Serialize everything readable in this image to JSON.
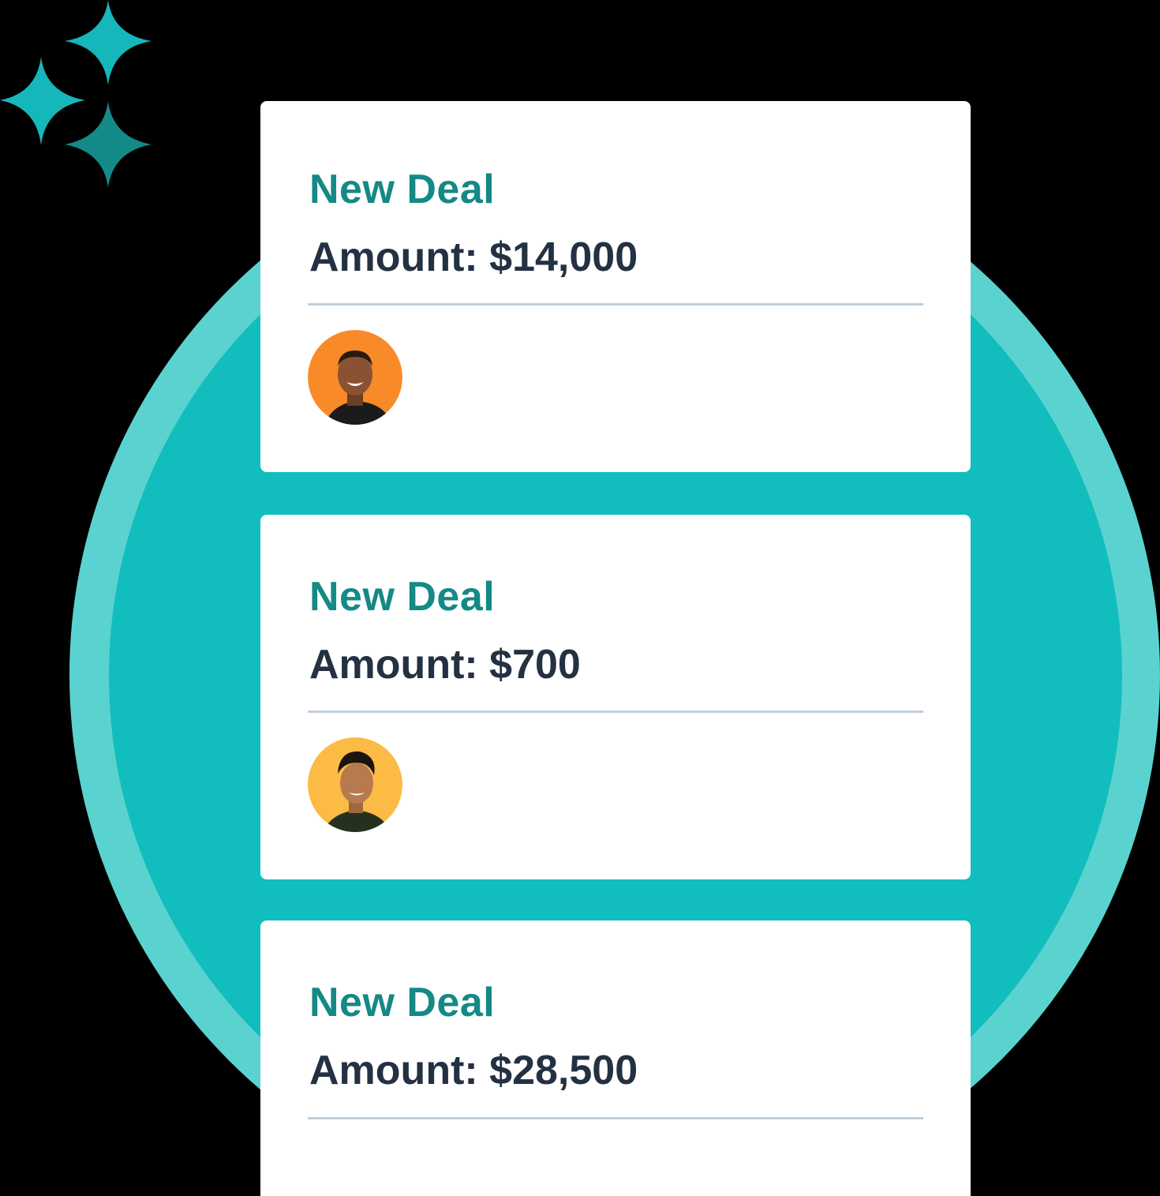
{
  "cards": [
    {
      "title": "New Deal",
      "amount_text": "Amount: $14,000",
      "avatar": {
        "icon": "person-avatar-icon",
        "background": "#f98a28"
      }
    },
    {
      "title": "New Deal",
      "amount_text": "Amount: $700",
      "avatar": {
        "icon": "person-avatar-icon",
        "background": "#fbbb45"
      }
    },
    {
      "title": "New Deal",
      "amount_text": "Amount: $28,500"
    }
  ],
  "colors": {
    "background": "#000000",
    "circle_outer": "#5ad3d0",
    "circle_inner": "#12bdbd",
    "title": "#148986",
    "amount": "#233142",
    "divider": "#c1cfdb",
    "sparkle_light": "#16b7bb",
    "sparkle_dark": "#138a88"
  },
  "decorations": {
    "sparkles_icon": "sparkles-icon"
  }
}
